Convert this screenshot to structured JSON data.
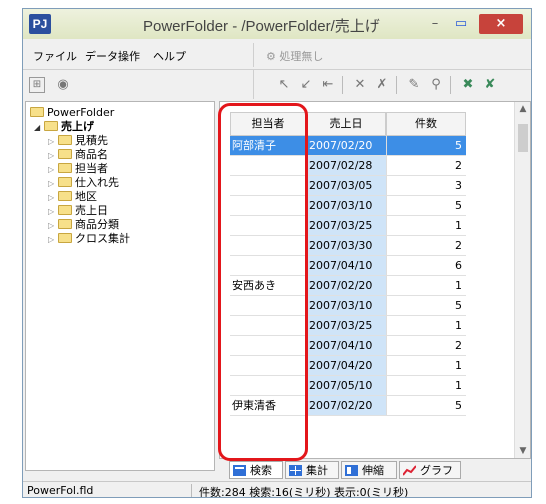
{
  "window": {
    "app_icon": "PJ",
    "title": "PowerFolder - /PowerFolder/売上げ",
    "min_glyph": "–",
    "max_glyph": "▭",
    "close_glyph": "×"
  },
  "menu": [
    "ファイル",
    "データ操作",
    "ヘルプ"
  ],
  "toolbar": {
    "hold_label": "処理無し",
    "left_icons": [
      "table-icon",
      "eye-icon"
    ],
    "right_icons": [
      "arrow-up-left-icon",
      "arrow-down-left-icon",
      "arrow-left-icon",
      "cross-icon",
      "cross-alt-icon",
      "eraser-icon",
      "pin-icon",
      "close-filter-icon",
      "close-filter-alt-icon"
    ]
  },
  "tree": {
    "root": "PowerFolder",
    "selected": "売上げ",
    "children": [
      "見積先",
      "商品名",
      "担当者",
      "仕入れ先",
      "地区",
      "売上日",
      "商品分類",
      "クロス集計"
    ]
  },
  "grid": {
    "headers": [
      "担当者",
      "売上日",
      "件数"
    ],
    "rows": [
      {
        "name": "阿部清子",
        "date": "2007/02/20",
        "count": "5",
        "selected": true
      },
      {
        "name": "",
        "date": "2007/02/28",
        "count": "2",
        "selected": false
      },
      {
        "name": "",
        "date": "2007/03/05",
        "count": "3",
        "selected": false
      },
      {
        "name": "",
        "date": "2007/03/10",
        "count": "5",
        "selected": false
      },
      {
        "name": "",
        "date": "2007/03/25",
        "count": "1",
        "selected": false
      },
      {
        "name": "",
        "date": "2007/03/30",
        "count": "2",
        "selected": false
      },
      {
        "name": "",
        "date": "2007/04/10",
        "count": "6",
        "selected": false
      },
      {
        "name": "安西あき",
        "date": "2007/02/20",
        "count": "1",
        "selected": false
      },
      {
        "name": "",
        "date": "2007/03/10",
        "count": "5",
        "selected": false
      },
      {
        "name": "",
        "date": "2007/03/25",
        "count": "1",
        "selected": false
      },
      {
        "name": "",
        "date": "2007/04/10",
        "count": "2",
        "selected": false
      },
      {
        "name": "",
        "date": "2007/04/20",
        "count": "1",
        "selected": false
      },
      {
        "name": "",
        "date": "2007/05/10",
        "count": "1",
        "selected": false
      },
      {
        "name": "伊東清香",
        "date": "2007/02/20",
        "count": "5",
        "selected": false
      }
    ]
  },
  "tabs": [
    "検索",
    "集計",
    "伸縮",
    "グラフ"
  ],
  "status": {
    "file": "PowerFol.fld",
    "info": "件数:284  検索:16(ミリ秒)  表示:0(ミリ秒)"
  },
  "colors": {
    "selection": "#3d8ee6",
    "highlight_border": "#e3161b",
    "close_button": "#c7433b"
  }
}
